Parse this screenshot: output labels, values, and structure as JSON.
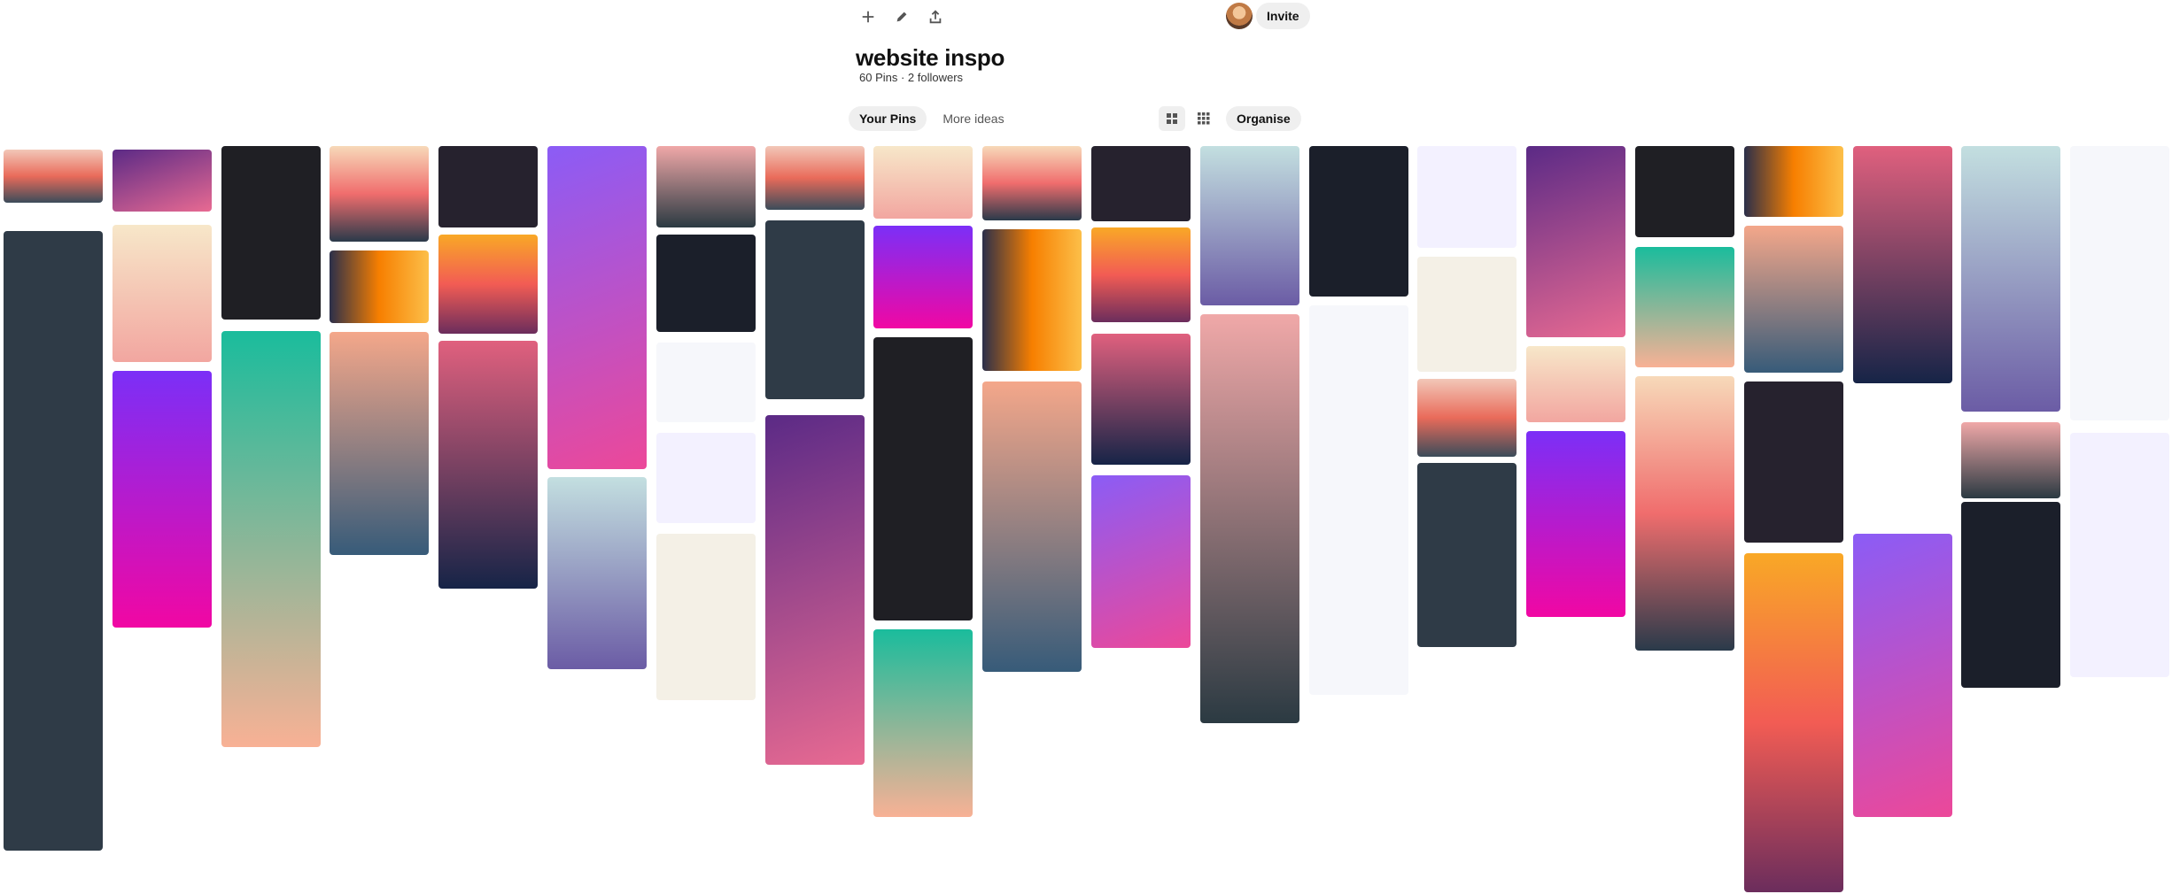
{
  "toolbar": {
    "icons": [
      "add-icon",
      "edit-icon",
      "share-icon"
    ],
    "invite_label": "Invite"
  },
  "board": {
    "title": "website inspo",
    "stats": "60 Pins · 2 followers"
  },
  "tabs": [
    {
      "label": "Your Pins",
      "active": true
    },
    {
      "label": "More ideas",
      "active": false
    }
  ],
  "view": {
    "options": [
      "default-layout-icon",
      "compact-layout-icon"
    ],
    "selected": "default-layout-icon",
    "organise_label": "Organise"
  },
  "colors": {
    "chip": "#efefef",
    "text": "#111111"
  },
  "pins": {
    "count_visible": 60
  }
}
